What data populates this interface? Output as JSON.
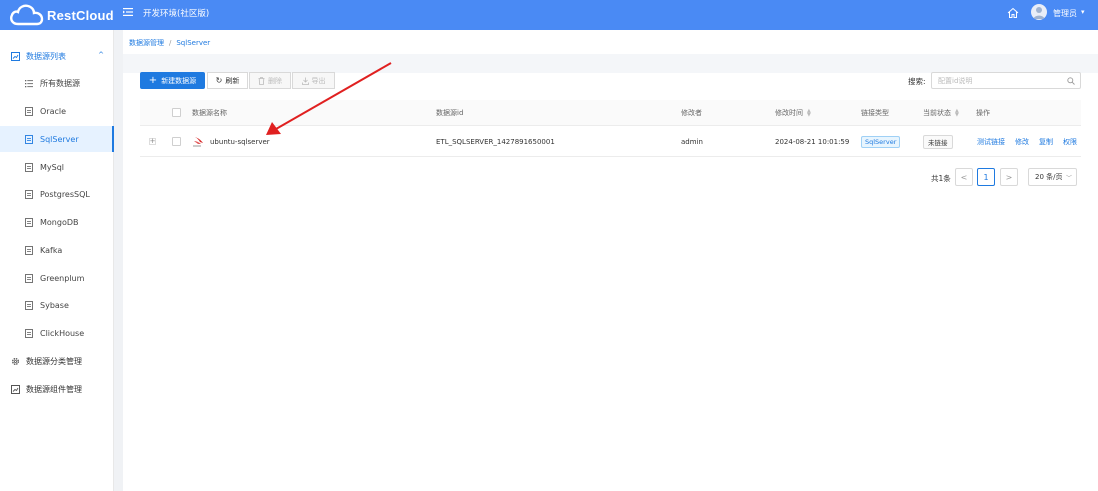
{
  "header": {
    "logo_text": "RestCloud",
    "env_title": "开发环境(社区版)",
    "user_name": "管理员",
    "caret": "▾"
  },
  "sidebar": {
    "group_datasource_list": "数据源列表",
    "group_caret": "^",
    "items": [
      {
        "label": "所有数据源",
        "icon": "list-icon"
      },
      {
        "label": "Oracle",
        "icon": "document-icon"
      },
      {
        "label": "SqlServer",
        "icon": "document-icon",
        "active": true
      },
      {
        "label": "MySql",
        "icon": "document-icon"
      },
      {
        "label": "PostgresSQL",
        "icon": "document-icon"
      },
      {
        "label": "MongoDB",
        "icon": "document-icon"
      },
      {
        "label": "Kafka",
        "icon": "document-icon"
      },
      {
        "label": "Greenplum",
        "icon": "document-icon"
      },
      {
        "label": "Sybase",
        "icon": "document-icon"
      },
      {
        "label": "ClickHouse",
        "icon": "document-icon"
      }
    ],
    "group_category_mgmt": "数据源分类管理",
    "group_component_mgmt": "数据源组件管理"
  },
  "breadcrumb": {
    "root": "数据源管理",
    "separator": "/",
    "current": "SqlServer"
  },
  "toolbar": {
    "new_label": "新建数据源",
    "refresh_label": "刷新",
    "delete_label": "删除",
    "export_label": "导出"
  },
  "search": {
    "label": "搜索:",
    "placeholder": "配置id说明"
  },
  "table": {
    "columns": {
      "name": "数据源名称",
      "id": "数据源id",
      "modifier": "修改者",
      "modified_time": "修改时间",
      "link_type": "链接类型",
      "status": "当前状态",
      "ops": "操作"
    },
    "rows": [
      {
        "expand": "+",
        "name": "ubuntu-sqlserver",
        "id": "ETL_SQLSERVER_1427891650001",
        "modifier": "admin",
        "modified_time": "2024-08-21 10:01:59",
        "link_type": "SqlServer",
        "status": "未链接",
        "ops": {
          "test": "测试链接",
          "edit": "修改",
          "copy": "复制",
          "perm": "权限"
        }
      }
    ]
  },
  "pagination": {
    "total": "共1条",
    "prev": "<",
    "current_page": "1",
    "next": ">",
    "page_size": "20 条/页"
  },
  "colors": {
    "brand": "#4a8af4",
    "primary": "#1f7ae0",
    "annotation_arrow": "#e02020"
  }
}
